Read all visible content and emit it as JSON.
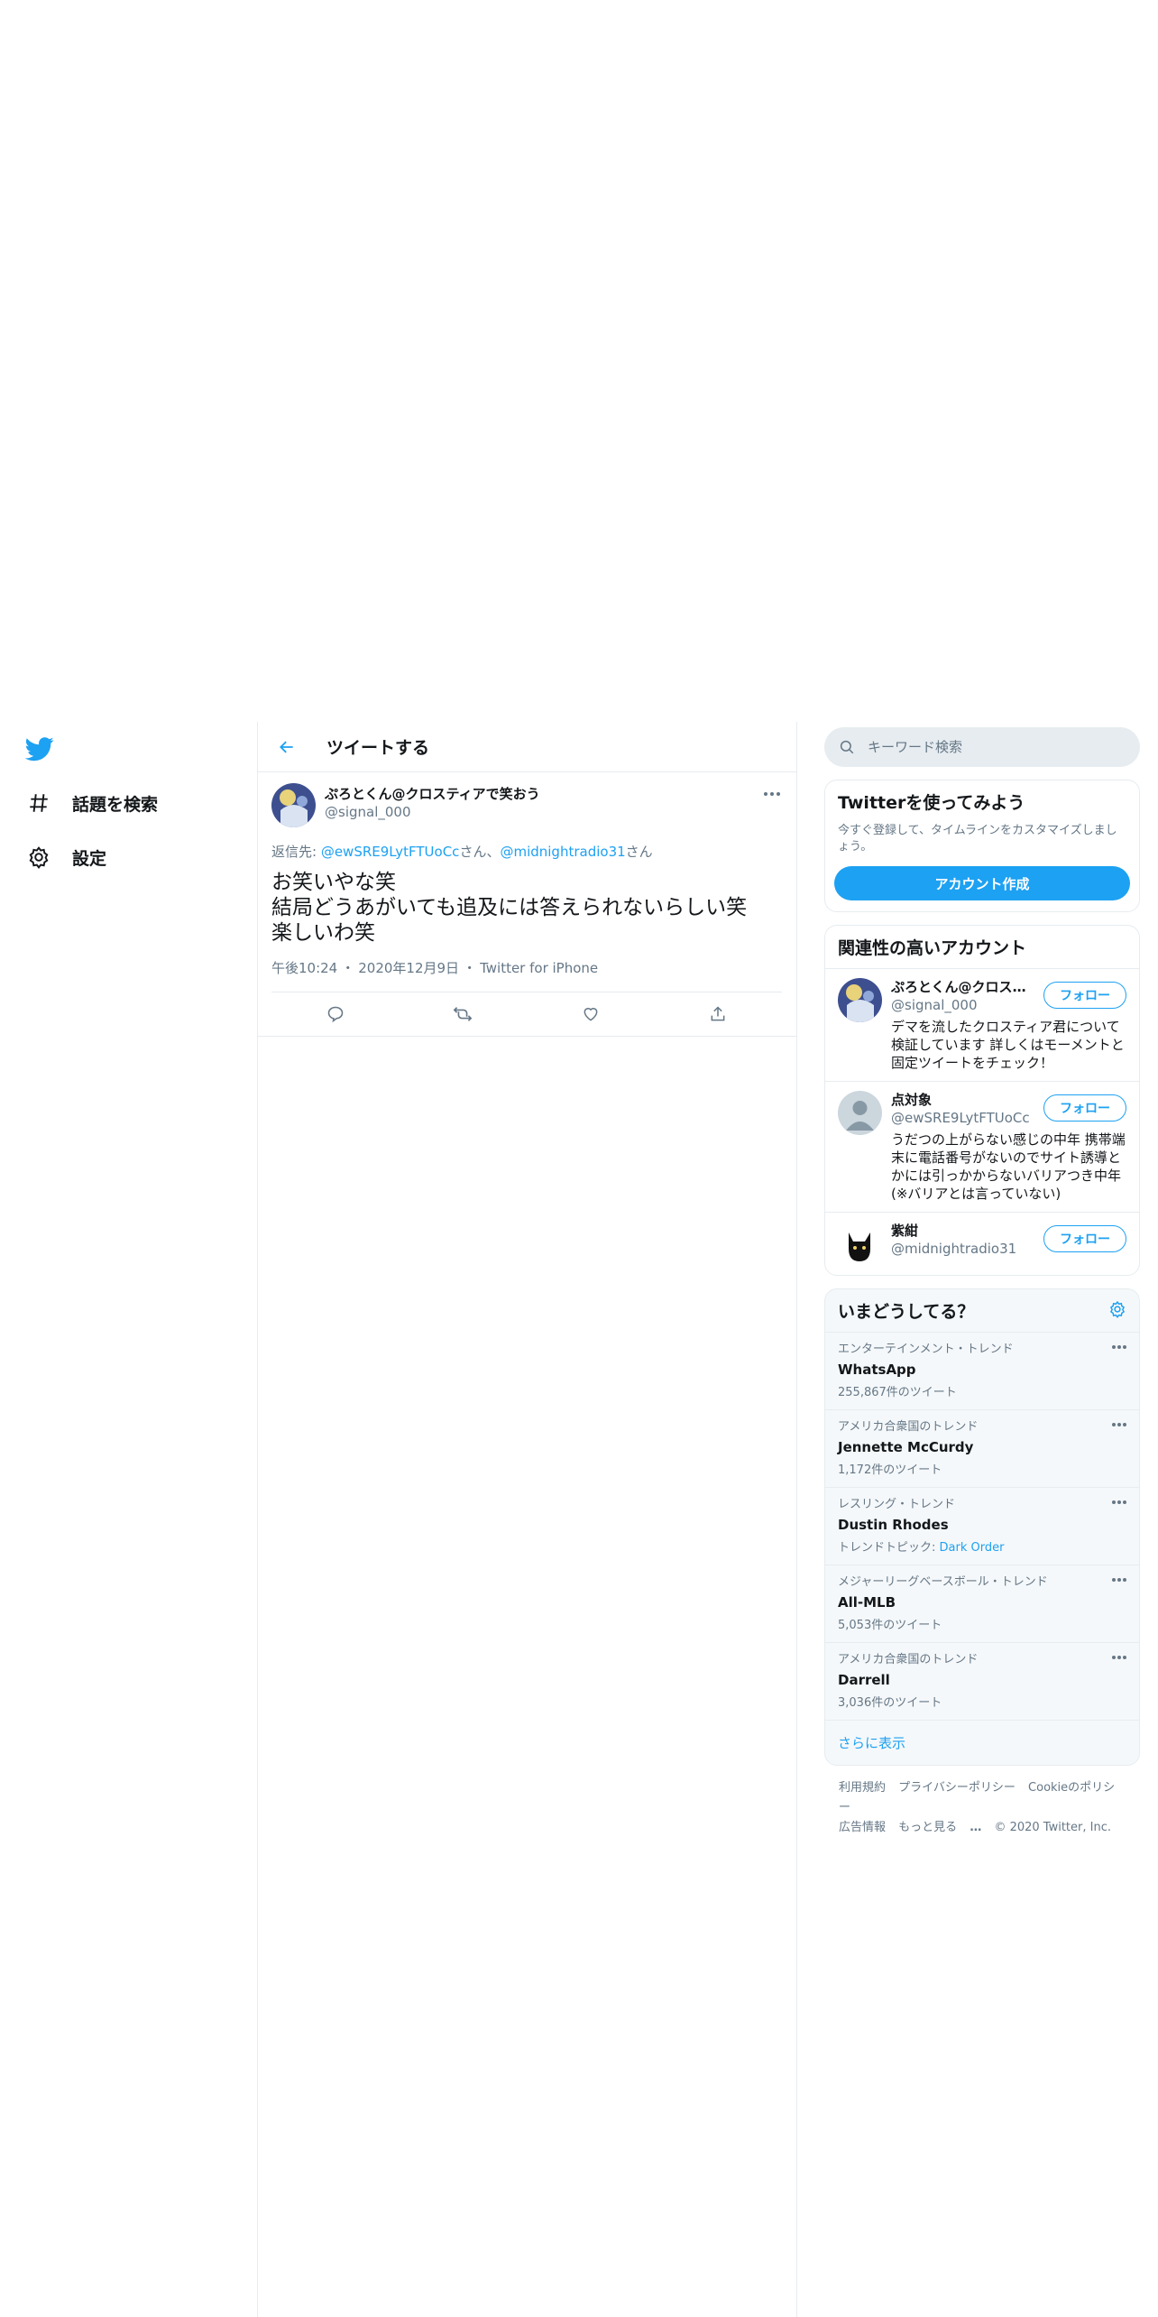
{
  "nav": {
    "items": [
      {
        "label": "話題を検索",
        "icon": "hashtag-icon"
      },
      {
        "label": "設定",
        "icon": "gear-icon"
      }
    ]
  },
  "header": {
    "title": "ツイートする"
  },
  "tweet": {
    "name": "ぷろとくん@クロスティアで笑おう",
    "handle": "@signal_000",
    "reply_prefix": "返信先: ",
    "reply_user1": "@ewSRE9LytFTUoCc",
    "reply_san1": "さん、",
    "reply_user2": "@midnightradio31",
    "reply_san2": "さん",
    "text_line1": "お笑いやな笑",
    "text_line2": "結局どうあがいても追及には答えられないらしい笑",
    "text_line3": "楽しいわ笑",
    "time": "午後10:24",
    "date": "2020年12月9日",
    "source": "Twitter for iPhone",
    "sep": "・"
  },
  "search": {
    "placeholder": "キーワード検索"
  },
  "signup": {
    "title": "Twitterを使ってみよう",
    "desc": "今すぐ登録して、タイムラインをカスタマイズしましょう。",
    "button": "アカウント作成"
  },
  "related": {
    "title": "関連性の高いアカウント",
    "follow_label": "フォロー",
    "accounts": [
      {
        "name": "ぷろとくん@クロスティアで笑おう",
        "handle": "@signal_000",
        "bio": "デマを流したクロスティア君について検証しています 詳しくはモーメントと固定ツイートをチェック！"
      },
      {
        "name": "点対象",
        "handle": "@ewSRE9LytFTUoCc",
        "bio": "うだつの上がらない感じの中年 携帯端末に電話番号がないのでサイト誘導とかには引っかからないバリアつき中年(※バリアとは言っていない)"
      },
      {
        "name": "紫紺",
        "handle": "@midnightradio31",
        "bio": ""
      }
    ]
  },
  "trends": {
    "title": "いまどうしてる？",
    "items": [
      {
        "context": "エンターテインメント・トレンド",
        "name": "WhatsApp",
        "count": "255,867件のツイート"
      },
      {
        "context": "アメリカ合衆国のトレンド",
        "name": "Jennette McCurdy",
        "count": "1,172件のツイート"
      },
      {
        "context": "レスリング・トレンド",
        "name": "Dustin Rhodes",
        "count_prefix": "トレンドトピック: ",
        "count_link": "Dark Order"
      },
      {
        "context": "メジャーリーグベースボール・トレンド",
        "name": "All-MLB",
        "count": "5,053件のツイート"
      },
      {
        "context": "アメリカ合衆国のトレンド",
        "name": "Darrell",
        "count": "3,036件のツイート"
      }
    ],
    "show_more": "さらに表示"
  },
  "footer": {
    "links": [
      "利用規約",
      "プライバシーポリシー",
      "Cookieのポリシー",
      "広告情報",
      "もっと見る"
    ],
    "more_dots": "…",
    "copyright": "© 2020 Twitter, Inc."
  },
  "colors": {
    "accent": "#1da1f2",
    "secondary_text": "#657786",
    "border": "#e6ecf0"
  }
}
